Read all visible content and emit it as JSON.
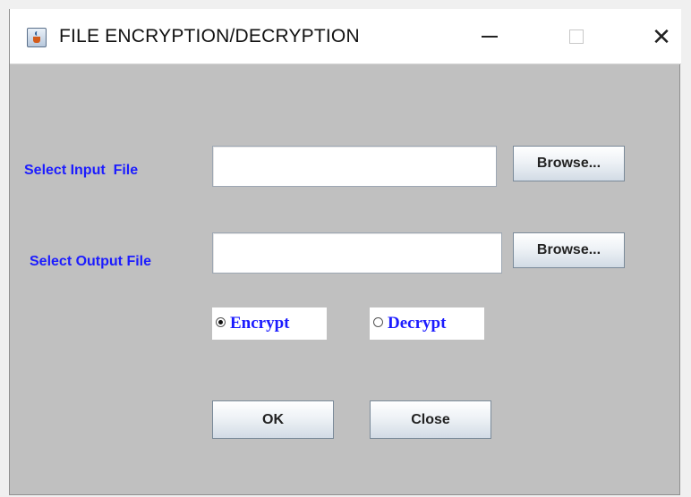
{
  "window": {
    "title": "FILE ENCRYPTION/DECRYPTION",
    "icon": "java-cup-icon",
    "close_glyph": "✕"
  },
  "form": {
    "input_label": "Select Input  File",
    "input_value": "",
    "output_label": "Select Output File",
    "output_value": "",
    "browse_label": "Browse...",
    "mode_options": [
      {
        "label": "Encrypt",
        "selected": true
      },
      {
        "label": "Decrypt",
        "selected": false
      }
    ],
    "ok_label": "OK",
    "close_label": "Close"
  },
  "colors": {
    "window_bg": "#c0c0c0",
    "label_color": "#1c1cff"
  }
}
